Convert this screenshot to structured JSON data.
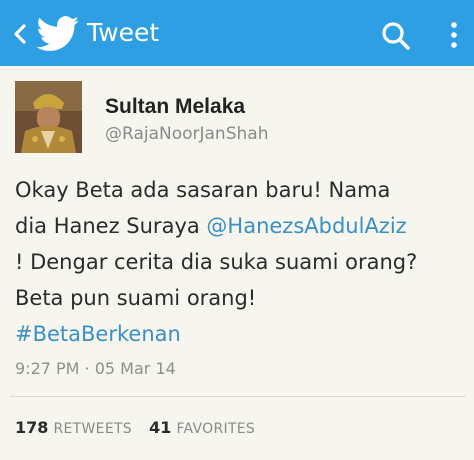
{
  "header": {
    "title": "Tweet",
    "back_icon": "chevron-left-icon",
    "logo_icon": "twitter-bird-icon",
    "search_icon": "search-icon",
    "menu_icon": "more-vertical-icon",
    "background_color": "#2d9fe2"
  },
  "tweet": {
    "author": {
      "display_name": "Sultan Melaka",
      "handle": "@RajaNoorJanShah"
    },
    "text": {
      "line1": "Okay Beta ada sasaran baru! Nama",
      "line2_text": "dia Hanez Suraya ",
      "line2_mention": "@HanezsAbdulAziz",
      "line3": "! Dengar cerita dia suka suami orang?",
      "line4": "Beta pun suami orang!",
      "hashtag": "#BetaBerkenan"
    },
    "timestamp": "9:27 PM · 05 Mar 14",
    "stats": {
      "retweets_count": "178",
      "retweets_label": "RETWEETS",
      "favorites_count": "41",
      "favorites_label": "FAVORITES"
    },
    "link_color": "#3a8fc4"
  }
}
